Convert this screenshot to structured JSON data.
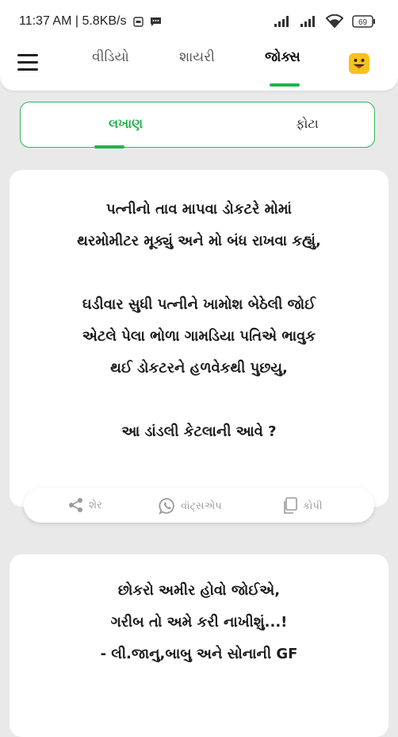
{
  "status_bar": {
    "time": "11:37 AM | 5.8KB/s",
    "battery": "69"
  },
  "tabs": [
    {
      "label": "વીડિયો",
      "active": false
    },
    {
      "label": "શાયરી",
      "active": false
    },
    {
      "label": "જોક્સ",
      "active": true
    }
  ],
  "segment": {
    "options": [
      "લખાણ",
      "ફોટા"
    ],
    "selected": "લખાણ"
  },
  "jokes": [
    {
      "text": "પત્નીનો તાવ માપવા ડોકટરે મોમાં\nથરમોમીટર મૂક્યું અને મો બંધ રાખવા કહ્યું,\n\nઘડીવાર સુધી પત્નીને ખામોશ બેઠેલી જોઈ\nએટલે પેલા ભોળા ગામડિયા પતિએ ભાવુક\nથઈ ડોકટરને હળવેકથી પુછયુ,\n\nઆ ડાંડલી કેટલાની આવે ?"
    },
    {
      "text": "છોકરો અમીર હોવો જોઈએ,\nગરીબ તો અમે કરી નાખીશું...!\n- લી.જાનુ,બાબુ  અને સોનાની GF"
    }
  ],
  "actions": {
    "share": "શેર",
    "whatsapp": "વૉટ્સએપ",
    "copy": "કોપી"
  },
  "colors": {
    "accent": "#22b24c",
    "background": "#e9e9e9",
    "emoji_bg": "#f6c21c"
  },
  "icons": [
    "menu-icon",
    "share-icon",
    "whatsapp-icon",
    "copy-icon",
    "emoji-icon",
    "signal-icon",
    "wifi-icon",
    "battery-icon"
  ]
}
